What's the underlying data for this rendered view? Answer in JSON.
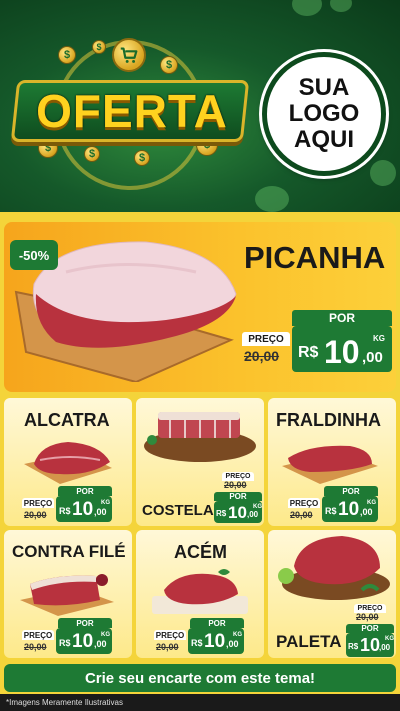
{
  "header": {
    "promo_word": "OFERTA",
    "logo_lines": [
      "SUA",
      "LOGO",
      "AQUI"
    ],
    "coin_symbol": "$",
    "icons": [
      "cart-icon",
      "coin-icon"
    ]
  },
  "hero": {
    "discount": "-50%",
    "name": "PICANHA",
    "price": {
      "label_old": "PREÇO",
      "old": "20,00",
      "label_new": "POR",
      "currency": "R$",
      "value": "10",
      "cents": ",00",
      "unit": "KG"
    }
  },
  "products": [
    {
      "name": "ALCATRA",
      "price": {
        "label_old": "PREÇO",
        "old": "20,00",
        "label_new": "POR",
        "currency": "R$",
        "value": "10",
        "cents": ",00",
        "unit": "KG"
      }
    },
    {
      "name": "COSTELA",
      "price": {
        "label_old": "PREÇO",
        "old": "20,00",
        "label_new": "POR",
        "currency": "R$",
        "value": "10",
        "cents": ",00",
        "unit": "KG"
      }
    },
    {
      "name": "FRALDINHA",
      "price": {
        "label_old": "PREÇO",
        "old": "20,00",
        "label_new": "POR",
        "currency": "R$",
        "value": "10",
        "cents": ",00",
        "unit": "KG"
      }
    },
    {
      "name": "CONTRA FILÉ",
      "price": {
        "label_old": "PREÇO",
        "old": "20,00",
        "label_new": "POR",
        "currency": "R$",
        "value": "10",
        "cents": ",00",
        "unit": "KG"
      }
    },
    {
      "name": "ACÉM",
      "price": {
        "label_old": "PREÇO",
        "old": "20,00",
        "label_new": "POR",
        "currency": "R$",
        "value": "10",
        "cents": ",00",
        "unit": "KG"
      }
    },
    {
      "name": "PALETA",
      "price": {
        "label_old": "PREÇO",
        "old": "20,00",
        "label_new": "POR",
        "currency": "R$",
        "value": "10",
        "cents": ",00",
        "unit": "KG"
      }
    }
  ],
  "cta": "Crie seu encarte com este tema!",
  "footnote": "*Imagens Meramente Ilustrativas",
  "colors": {
    "green": "#1e7a34",
    "dark_green": "#0b3b1a",
    "yellow": "#f4d43a",
    "orange": "#f6a51c",
    "meat": "#b8323e"
  }
}
